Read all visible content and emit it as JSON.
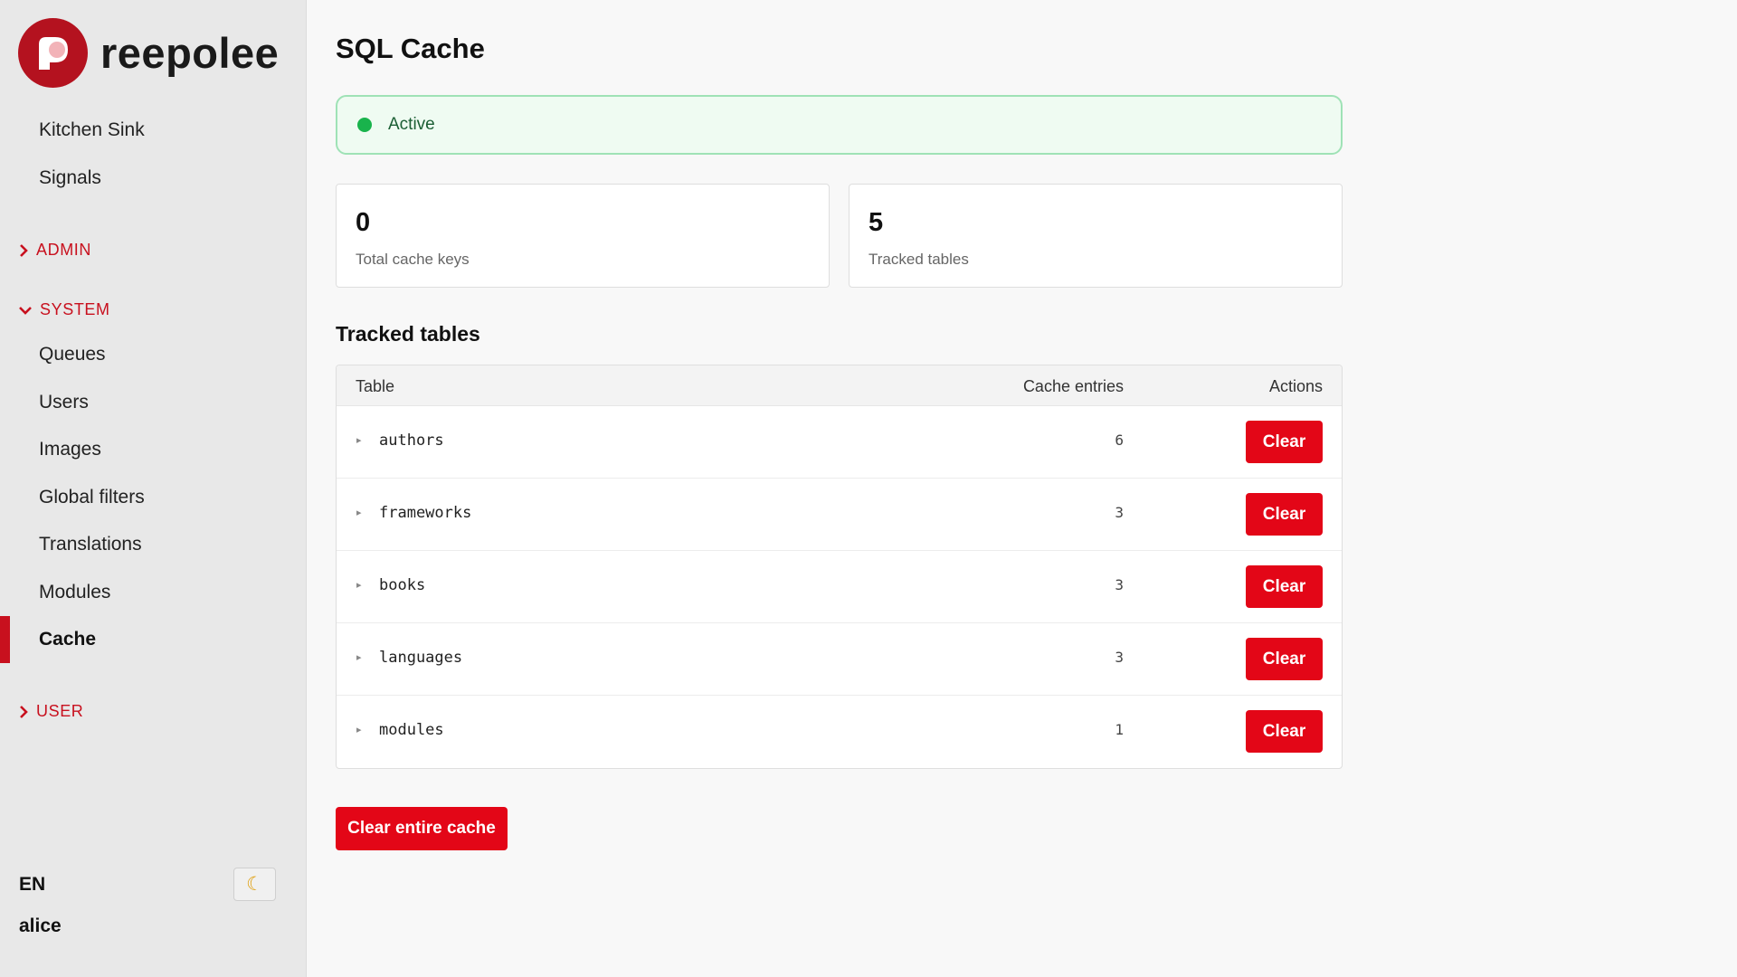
{
  "brand": {
    "name": "reepolee",
    "logo_color": "#b4121f"
  },
  "nav": {
    "top_items": [
      {
        "label": "Kitchen Sink"
      },
      {
        "label": "Signals"
      }
    ],
    "sections": {
      "admin": {
        "label": "ADMIN",
        "expanded": false
      },
      "system": {
        "label": "SYSTEM",
        "expanded": true
      },
      "user": {
        "label": "USER",
        "expanded": false
      }
    },
    "system_items": [
      {
        "label": "Queues"
      },
      {
        "label": "Users"
      },
      {
        "label": "Images"
      },
      {
        "label": "Global filters"
      },
      {
        "label": "Translations"
      },
      {
        "label": "Modules"
      },
      {
        "label": "Cache",
        "active": true
      }
    ]
  },
  "footer": {
    "language": "EN",
    "theme_icon": "moon-icon",
    "username": "alice"
  },
  "page": {
    "title": "SQL Cache",
    "status": {
      "text": "Active",
      "color": "#19b34c"
    },
    "stats": [
      {
        "value": "0",
        "label": "Total cache keys"
      },
      {
        "value": "5",
        "label": "Tracked tables"
      }
    ],
    "tracked_tables": {
      "title": "Tracked tables",
      "columns": {
        "table": "Table",
        "entries": "Cache entries",
        "actions": "Actions"
      },
      "rows": [
        {
          "name": "authors",
          "entries": "6",
          "action": "Clear"
        },
        {
          "name": "frameworks",
          "entries": "3",
          "action": "Clear"
        },
        {
          "name": "books",
          "entries": "3",
          "action": "Clear"
        },
        {
          "name": "languages",
          "entries": "3",
          "action": "Clear"
        },
        {
          "name": "modules",
          "entries": "1",
          "action": "Clear"
        }
      ]
    },
    "clear_all_label": "Clear entire cache",
    "accent_color": "#e30617"
  }
}
